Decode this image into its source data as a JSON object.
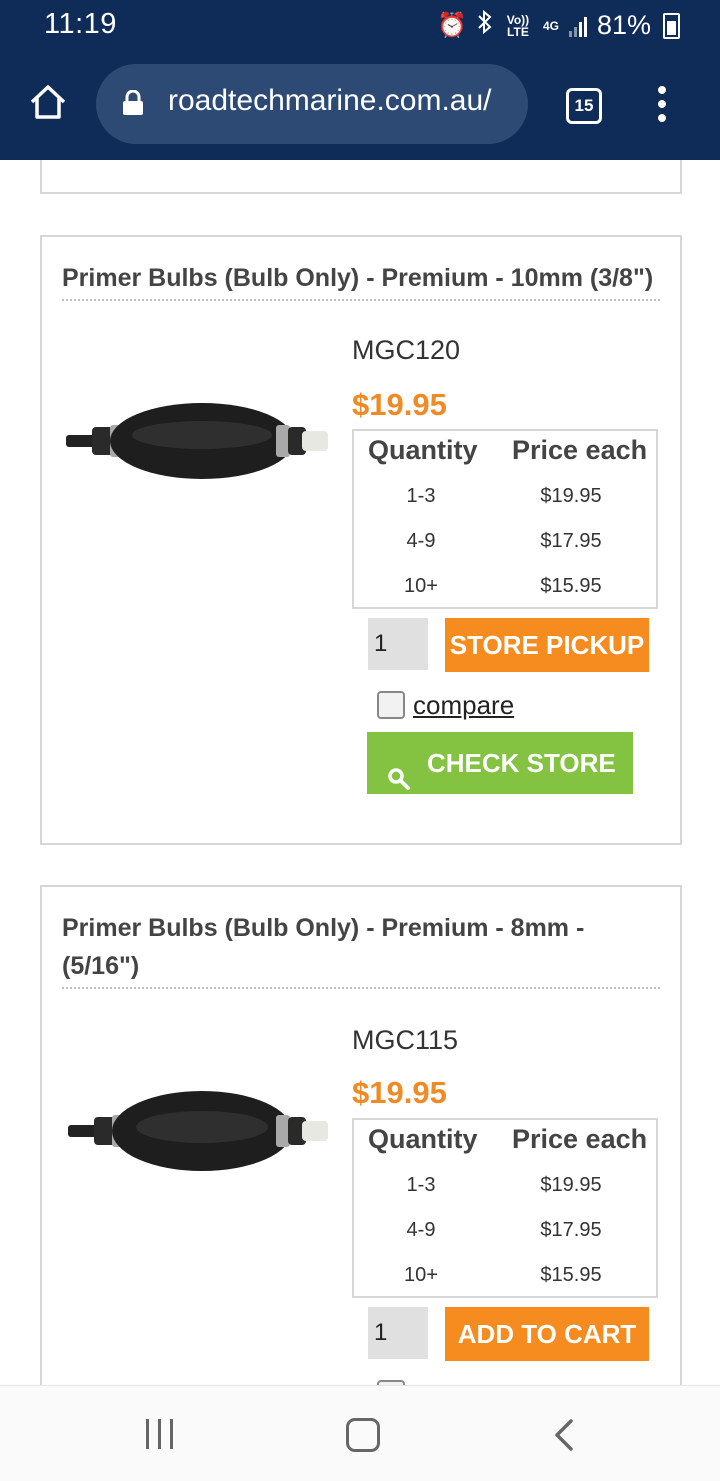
{
  "status_bar": {
    "time": "11:19",
    "volte": "Vo)) LTE",
    "network": "4G",
    "battery": "81%"
  },
  "browser": {
    "url": "roadtechmarine.com.au/",
    "tab_count": "15"
  },
  "products": [
    {
      "title": "Primer Bulbs (Bulb Only) - Premium - 10mm (3/8\")",
      "sku": "MGC120",
      "price": "$19.95",
      "table_headers": [
        "Quantity",
        "Price each"
      ],
      "tiers": [
        {
          "qty": "1-3",
          "price": "$19.95"
        },
        {
          "qty": "4-9",
          "price": "$17.95"
        },
        {
          "qty": "10+",
          "price": "$15.95"
        }
      ],
      "quantity": "1",
      "cart_button": "STORE PICKUP",
      "compare_label": "compare",
      "check_store_label": "CHECK STORE"
    },
    {
      "title": "Primer Bulbs (Bulb Only) - Premium - 8mm - (5/16\")",
      "sku": "MGC115",
      "price": "$19.95",
      "table_headers": [
        "Quantity",
        "Price each"
      ],
      "tiers": [
        {
          "qty": "1-3",
          "price": "$19.95"
        },
        {
          "qty": "4-9",
          "price": "$17.95"
        },
        {
          "qty": "10+",
          "price": "$15.95"
        }
      ],
      "quantity": "1",
      "cart_button": "ADD TO CART"
    }
  ],
  "colors": {
    "header_bg": "#0f2b57",
    "price": "#f08a24",
    "cart_button": "#f68b1f",
    "check_store_button": "#84c341"
  }
}
